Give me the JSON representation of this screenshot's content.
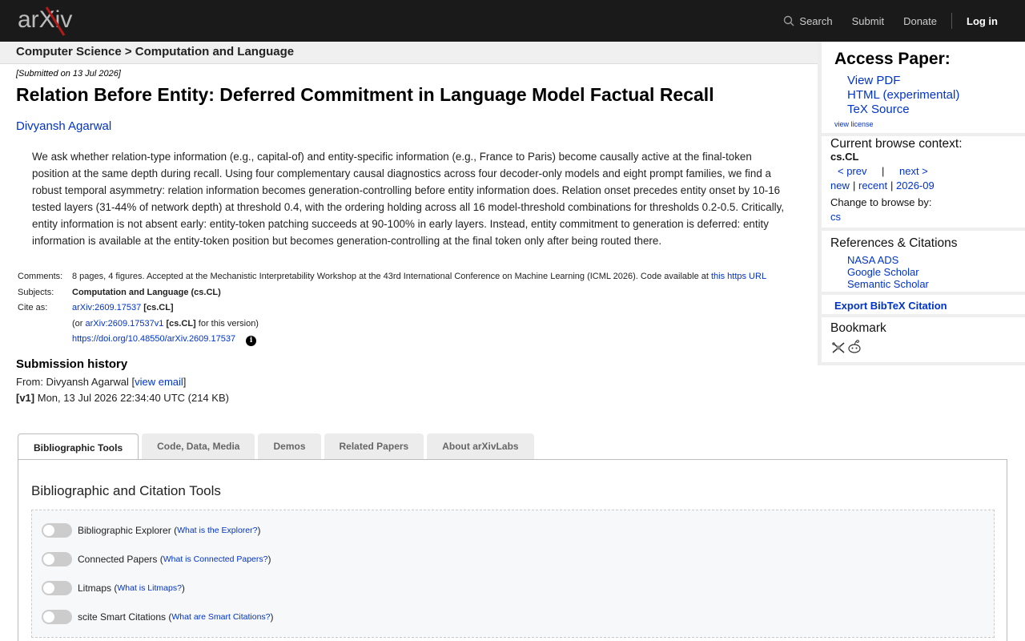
{
  "header": {
    "logo_text": "arXiv",
    "search_label": "Search",
    "submit_label": "Submit",
    "donate_label": "Donate",
    "login_label": "Log in"
  },
  "breadcrumb": "Computer Science > Computation and Language",
  "paper": {
    "submitted": "[Submitted on 13 Jul 2026]",
    "title": "Relation Before Entity: Deferred Commitment in Language Model Factual Recall",
    "author": "Divyansh Agarwal",
    "abstract": "We ask whether relation-type information (e.g., capital-of) and entity-specific information (e.g., France to Paris) become causally active at the final-token position at the same depth during recall. Using four complementary causal diagnostics across four decoder-only models and eight prompt families, we find a robust temporal asymmetry: relation information becomes generation-controlling before entity information does. Relation onset precedes entity onset by 10-16 tested layers (31-44% of network depth) at threshold 0.4, with the ordering holding across all 16 model-threshold combinations for thresholds 0.2-0.5. Critically, entity information is not absent early: entity-token patching succeeds at 90-100% in early layers. Instead, entity commitment to generation is deferred: entity information is available at the entity-token position but becomes generation-controlling at the final token only after being routed there."
  },
  "meta": {
    "comments_label": "Comments:",
    "comments": "8 pages, 4 figures. Accepted at the Mechanistic Interpretability Workshop at the 43rd International Conference on Machine Learning (ICML 2026). Code available at",
    "comments_link": "this https URL",
    "subjects_label": "Subjects:",
    "subjects": "Computation and Language (cs.CL)",
    "cite_label": "Cite as:",
    "cite_id": "arXiv:2609.17537",
    "cite_cat": "[cs.CL]",
    "version_pre": "(or",
    "version_id": "arXiv:2609.17537v1",
    "version_cat": "[cs.CL]",
    "version_post": "for this version)",
    "doi": "https://doi.org/10.48550/arXiv.2609.17537"
  },
  "history": {
    "title": "Submission history",
    "from_pre": "From: Divyansh Agarwal [",
    "from_link": "view email",
    "from_post": "]",
    "v1_label": "[v1]",
    "v1_text": "Mon, 13 Jul 2026 22:34:40 UTC (214 KB)"
  },
  "sidebar": {
    "access_title": "Access Paper:",
    "view_pdf": "View PDF",
    "html": "HTML (experimental)",
    "tex": "TeX Source",
    "view_license": "view license",
    "context_title": "Current browse context:",
    "context_cat": "cs.CL",
    "prev": "< prev",
    "pipe": "|",
    "next": "next >",
    "new": "new",
    "recent": "recent",
    "month": "2026-09",
    "change_label": "Change to browse by:",
    "cs": "cs",
    "refs_title": "References & Citations",
    "nasa": "NASA ADS",
    "scholar": "Google Scholar",
    "semantic": "Semantic Scholar",
    "export": "Export BibTeX Citation",
    "bookmark": "Bookmark"
  },
  "tabs": [
    "Bibliographic Tools",
    "Code, Data, Media",
    "Demos",
    "Related Papers",
    "About arXivLabs"
  ],
  "panel": {
    "title": "Bibliographic and Citation Tools",
    "tools": [
      {
        "label": "Bibliographic Explorer",
        "link": "What is the Explorer?"
      },
      {
        "label": "Connected Papers",
        "link": "What is Connected Papers?"
      },
      {
        "label": "Litmaps",
        "link": "What is Litmaps?"
      },
      {
        "label": "scite Smart Citations",
        "link": "What are Smart Citations?"
      }
    ]
  }
}
